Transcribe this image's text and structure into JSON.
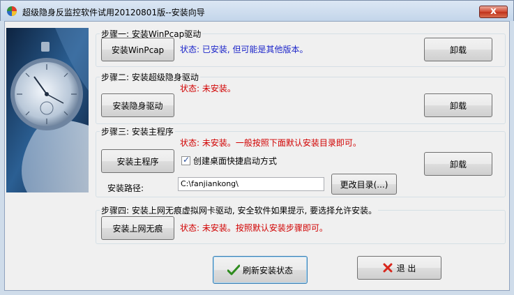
{
  "window": {
    "title": "超级隐身反监控软件试用20120801版--安装向导",
    "close_label": "x"
  },
  "step1": {
    "legend": "步骤一: 安装WinPcap驱动",
    "install_label": "安装WinPcap",
    "status": "状态: 已安装, 但可能是其他版本。",
    "uninstall_label": "卸载"
  },
  "step2": {
    "legend": "步骤二: 安装超级隐身驱动",
    "install_label": "安装隐身驱动",
    "status": "状态: 未安装。",
    "uninstall_label": "卸载"
  },
  "step3": {
    "legend": "步骤三: 安装主程序",
    "install_label": "安装主程序",
    "status": "状态: 未安装。一般按照下面默认安装目录即可。",
    "shortcut_label": "创建桌面快捷启动方式",
    "shortcut_checked": true,
    "path_label": "安装路径:",
    "path_value": "C:\\fanjiankong\\",
    "change_dir_label": "更改目录(...)",
    "uninstall_label": "卸载"
  },
  "step4": {
    "legend": "步骤四: 安装上网无痕虚拟网卡驱动, 安全软件如果提示, 要选择允许安装。",
    "install_label": "安装上网无痕",
    "status": "状态: 未安装。按照默认安装步骤即可。"
  },
  "footer": {
    "refresh_label": "刷新安装状态",
    "exit_label": "退 出"
  },
  "colors": {
    "status_ok": "#1b24c9",
    "status_missing": "#d10000",
    "refresh_icon": "#2e8b1e",
    "exit_icon": "#d8261c"
  }
}
